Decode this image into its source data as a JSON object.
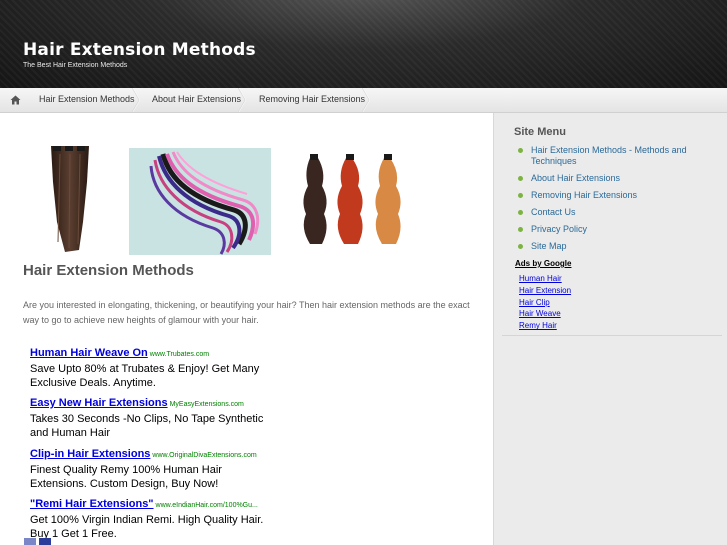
{
  "site": {
    "title": "Hair Extension Methods",
    "tagline": "The Best Hair Extension Methods"
  },
  "nav": {
    "home_icon": "home-icon",
    "items": [
      {
        "label": "Hair Extension Methods"
      },
      {
        "label": "About Hair Extensions"
      },
      {
        "label": "Removing Hair Extensions"
      }
    ]
  },
  "main": {
    "heading": "Hair Extension Methods",
    "intro": "Are you interested in elongating, thickening, or beautifying your hair?  Then hair extension methods are the exact way to go to achieve new heights of glamour with your hair.",
    "ads": [
      {
        "title": "Human Hair Weave On",
        "url": "www.Trubates.com",
        "desc": "Save Upto 80% at Trubates & Enjoy! Get Many Exclusive Deals. Anytime."
      },
      {
        "title": "Easy New Hair Extensions",
        "url": "MyEasyExtensions.com",
        "desc": "Takes 30 Seconds -No Clips, No Tape Synthetic and Human Hair"
      },
      {
        "title": "Clip-in Hair Extensions",
        "url": "www.OriginalDivaExtensions.com",
        "desc": "Finest Quality Remy 100% Human Hair Extensions. Custom Design, Buy Now!"
      },
      {
        "title": "\"Remi Hair Extensions\"",
        "url": "www.eIndianHair.com/100%Gu...",
        "desc": "Get 100% Virgin Indian Remi. High Quality Hair. Buy 1 Get 1 Free."
      }
    ]
  },
  "sidebar": {
    "heading": "Site Menu",
    "menu": [
      {
        "label": "Hair Extension Methods - Methods and Techniques"
      },
      {
        "label": "About Hair Extensions"
      },
      {
        "label": "Removing Hair Extensions"
      },
      {
        "label": "Contact Us"
      },
      {
        "label": "Privacy Policy"
      },
      {
        "label": "Site Map"
      }
    ],
    "ads_by_google": "Ads by Google",
    "ad_links": [
      "Human Hair",
      "Hair Extension",
      "Hair Clip",
      "Hair Weave",
      "Remy Hair"
    ]
  },
  "colors": {
    "link": "#2a6a9a",
    "ad_title": "#0000dd",
    "ad_url": "#008000",
    "bullet": "#7cb342",
    "header_bg": "#1c1c1c"
  }
}
